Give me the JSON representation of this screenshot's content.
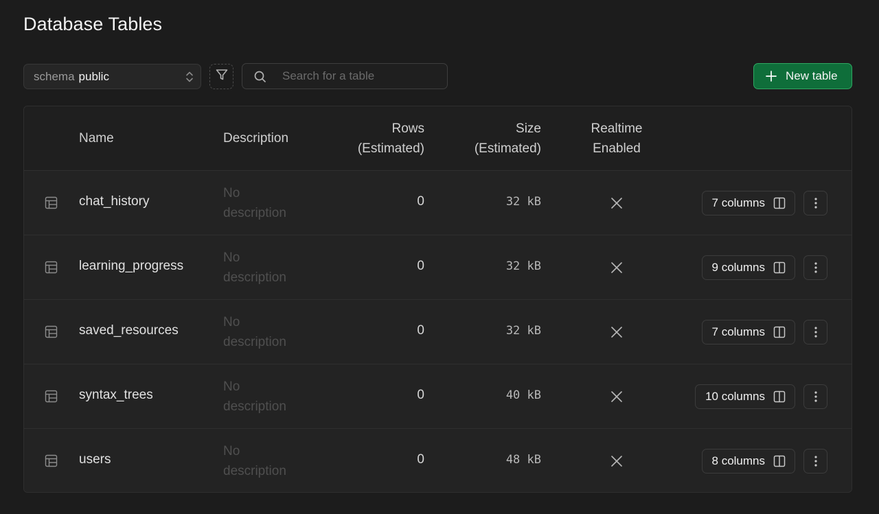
{
  "page": {
    "title": "Database Tables"
  },
  "toolbar": {
    "schema_key": "schema",
    "schema_value": "public",
    "search_placeholder": "Search for a table",
    "search_value": "",
    "new_table_label": "New table",
    "accent_color": "#0f6e3a"
  },
  "table": {
    "headers": {
      "name": "Name",
      "description": "Description",
      "rows_line1": "Rows",
      "rows_line2": "(Estimated)",
      "size_line1": "Size",
      "size_line2": "(Estimated)",
      "realtime_line1": "Realtime",
      "realtime_line2": "Enabled"
    },
    "rows": [
      {
        "name": "chat_history",
        "desc1": "No",
        "desc2": "description",
        "rows": "0",
        "size": "32 kB",
        "realtime_icon": "x-icon",
        "columns_label": "7 columns"
      },
      {
        "name": "learning_progress",
        "desc1": "No",
        "desc2": "description",
        "rows": "0",
        "size": "32 kB",
        "realtime_icon": "x-icon",
        "columns_label": "9 columns"
      },
      {
        "name": "saved_resources",
        "desc1": "No",
        "desc2": "description",
        "rows": "0",
        "size": "32 kB",
        "realtime_icon": "x-icon",
        "columns_label": "7 columns"
      },
      {
        "name": "syntax_trees",
        "desc1": "No",
        "desc2": "description",
        "rows": "0",
        "size": "40 kB",
        "realtime_icon": "x-icon",
        "columns_label": "10 columns"
      },
      {
        "name": "users",
        "desc1": "No",
        "desc2": "description",
        "rows": "0",
        "size": "48 kB",
        "realtime_icon": "x-icon",
        "columns_label": "8 columns"
      }
    ]
  }
}
